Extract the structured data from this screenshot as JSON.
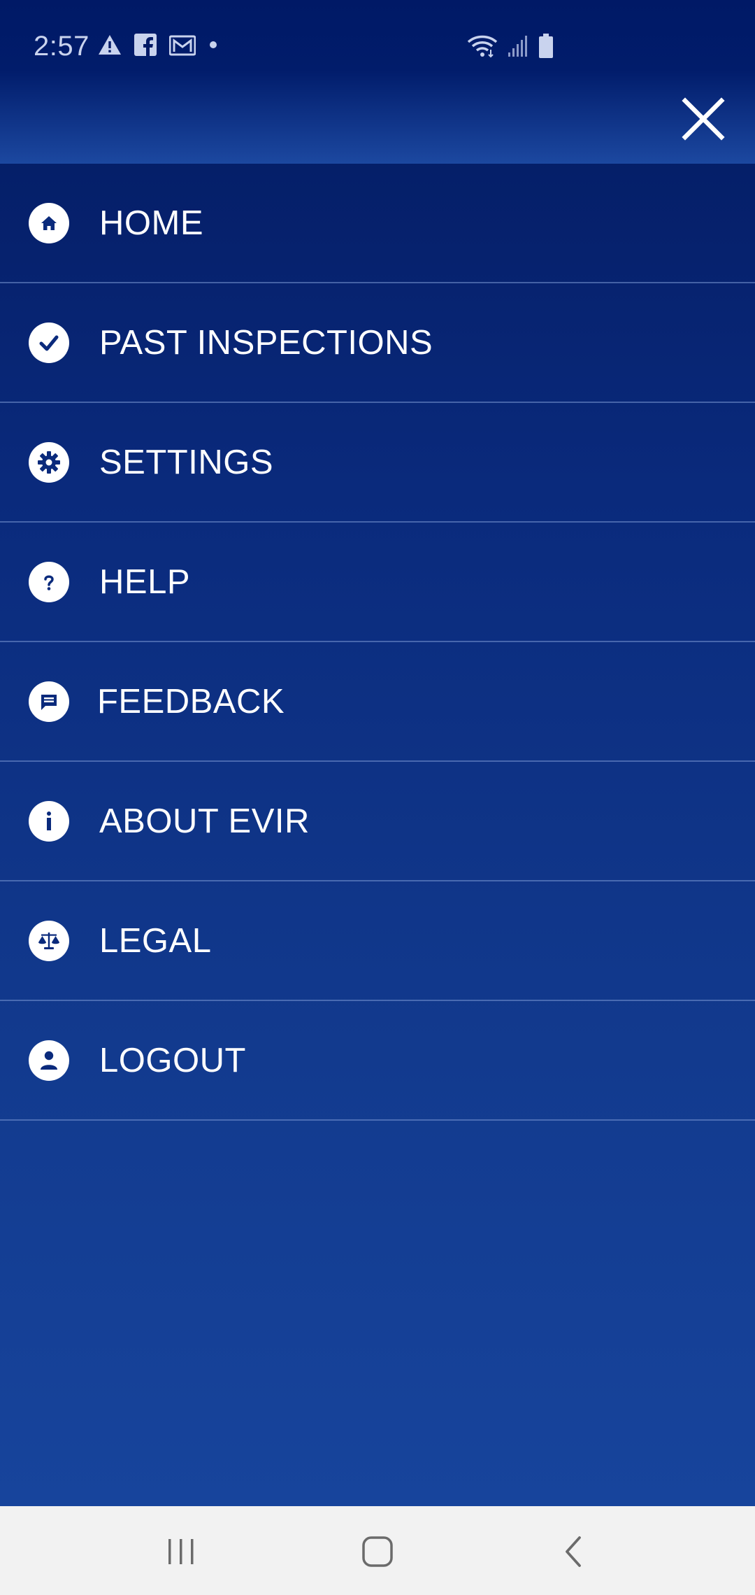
{
  "status_bar": {
    "time": "2:57",
    "left_icons": [
      "warning-icon",
      "facebook-icon",
      "gmail-icon",
      "notification-dot-icon"
    ],
    "right_icons": [
      "wifi-icon",
      "signal-icon",
      "battery-icon"
    ]
  },
  "header": {
    "close_icon": "close-icon"
  },
  "menu": {
    "items": [
      {
        "label": "HOME",
        "icon": "home-icon"
      },
      {
        "label": "PAST INSPECTIONS",
        "icon": "check-icon"
      },
      {
        "label": "SETTINGS",
        "icon": "gear-icon"
      },
      {
        "label": "HELP",
        "icon": "question-icon"
      },
      {
        "label": "FEEDBACK",
        "icon": "chat-icon"
      },
      {
        "label": "ABOUT EVIR",
        "icon": "info-icon"
      },
      {
        "label": "LEGAL",
        "icon": "scale-icon"
      },
      {
        "label": "LOGOUT",
        "icon": "user-icon"
      }
    ]
  },
  "nav_bar": {
    "buttons": [
      "recents-icon",
      "home-nav-icon",
      "back-icon"
    ]
  },
  "colors": {
    "menu_background_top": "#02195f",
    "menu_background_bottom": "#17449c",
    "icon_fill": "#ffffff",
    "icon_glyph": "#0a2a7c",
    "text": "#ffffff",
    "nav_bar": "#f2f2f2"
  }
}
